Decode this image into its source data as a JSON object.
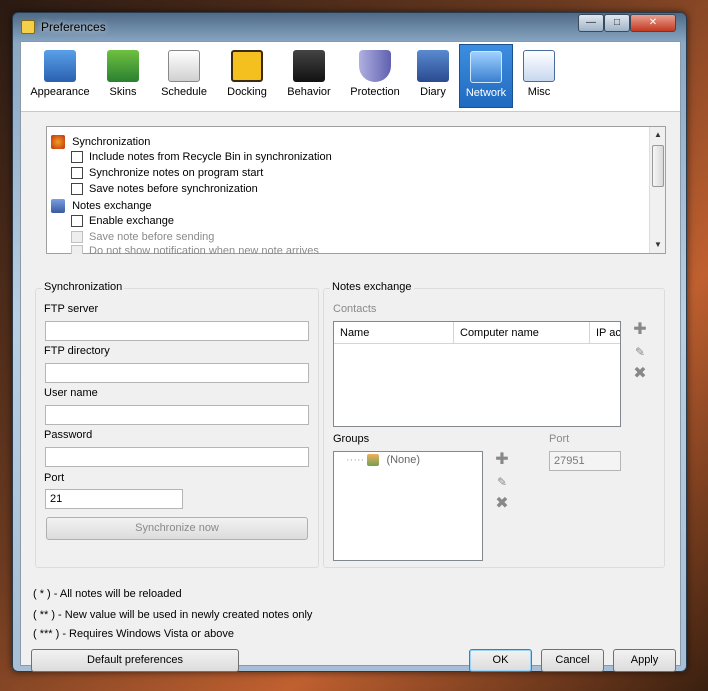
{
  "window": {
    "title": "Preferences"
  },
  "toolbar": {
    "items": [
      {
        "label": "Appearance",
        "icon": "appearance-icon"
      },
      {
        "label": "Skins",
        "icon": "skins-icon"
      },
      {
        "label": "Schedule",
        "icon": "schedule-icon"
      },
      {
        "label": "Docking",
        "icon": "docking-icon"
      },
      {
        "label": "Behavior",
        "icon": "behavior-icon"
      },
      {
        "label": "Protection",
        "icon": "protection-icon"
      },
      {
        "label": "Diary",
        "icon": "diary-icon"
      },
      {
        "label": "Network",
        "icon": "network-icon"
      },
      {
        "label": "Misc",
        "icon": "misc-icon"
      }
    ],
    "active": "Network"
  },
  "options": {
    "group1": "Synchronization",
    "item1": "Include notes from Recycle Bin in synchronization",
    "item2": "Synchronize notes on program start",
    "item3": "Save notes before synchronization",
    "group2": "Notes exchange",
    "item4": "Enable exchange",
    "item5": "Save note before sending",
    "item6": "Do not show notification when new note arrives"
  },
  "sync": {
    "title": "Synchronization",
    "ftp_server_label": "FTP server",
    "ftp_server_value": "",
    "ftp_dir_label": "FTP directory",
    "ftp_dir_value": "",
    "user_label": "User name",
    "user_value": "",
    "password_label": "Password",
    "password_value": "",
    "port_label": "Port",
    "port_value": "21",
    "sync_now": "Synchronize now"
  },
  "exchange": {
    "title": "Notes exchange",
    "contacts_label": "Contacts",
    "columns": [
      "Name",
      "Computer name",
      "IP ac"
    ],
    "groups_label": "Groups",
    "group_none": "(None)",
    "port_label": "Port",
    "port_value": "27951"
  },
  "footnotes": {
    "f1": "( * ) - All notes will be reloaded",
    "f2": "( ** ) - New value will be used in newly created notes only",
    "f3": "( *** ) - Requires Windows Vista or above"
  },
  "buttons": {
    "default_prefs": "Default preferences",
    "ok": "OK",
    "cancel": "Cancel",
    "apply": "Apply"
  },
  "colors": {
    "accent": "#1f6ac0",
    "window_frame": "#8aa7c3"
  }
}
